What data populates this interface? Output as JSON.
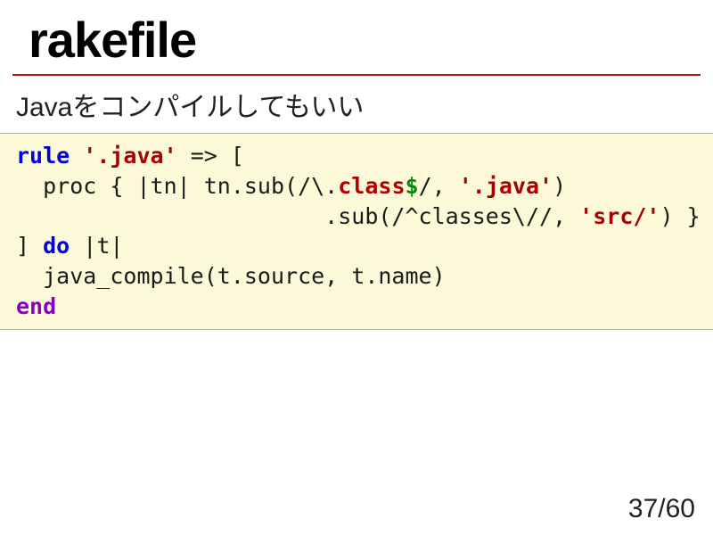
{
  "title": "rakefile",
  "subtitle": "Javaをコンパイルしてもいい",
  "code": {
    "l1_kw": "rule",
    "l1_str": " '.java'",
    "l1_rest": " => [",
    "l2_a": "  proc { |tn| tn.sub(/\\.",
    "l2_cls": "class",
    "l2_dollar": "$",
    "l2_b": "/,",
    "l2_str": " '.java'",
    "l2_c": ")",
    "l3_a": "                       .sub(/^classes\\//,",
    "l3_str": " 'src/'",
    "l3_b": ") }",
    "l4_a": "] ",
    "l4_kw": "do",
    "l4_b": " |t|",
    "l5": "  java_compile(t.source, t.name)",
    "l6_end": "end"
  },
  "page": {
    "current": "37",
    "sep": "/",
    "total": "60"
  }
}
